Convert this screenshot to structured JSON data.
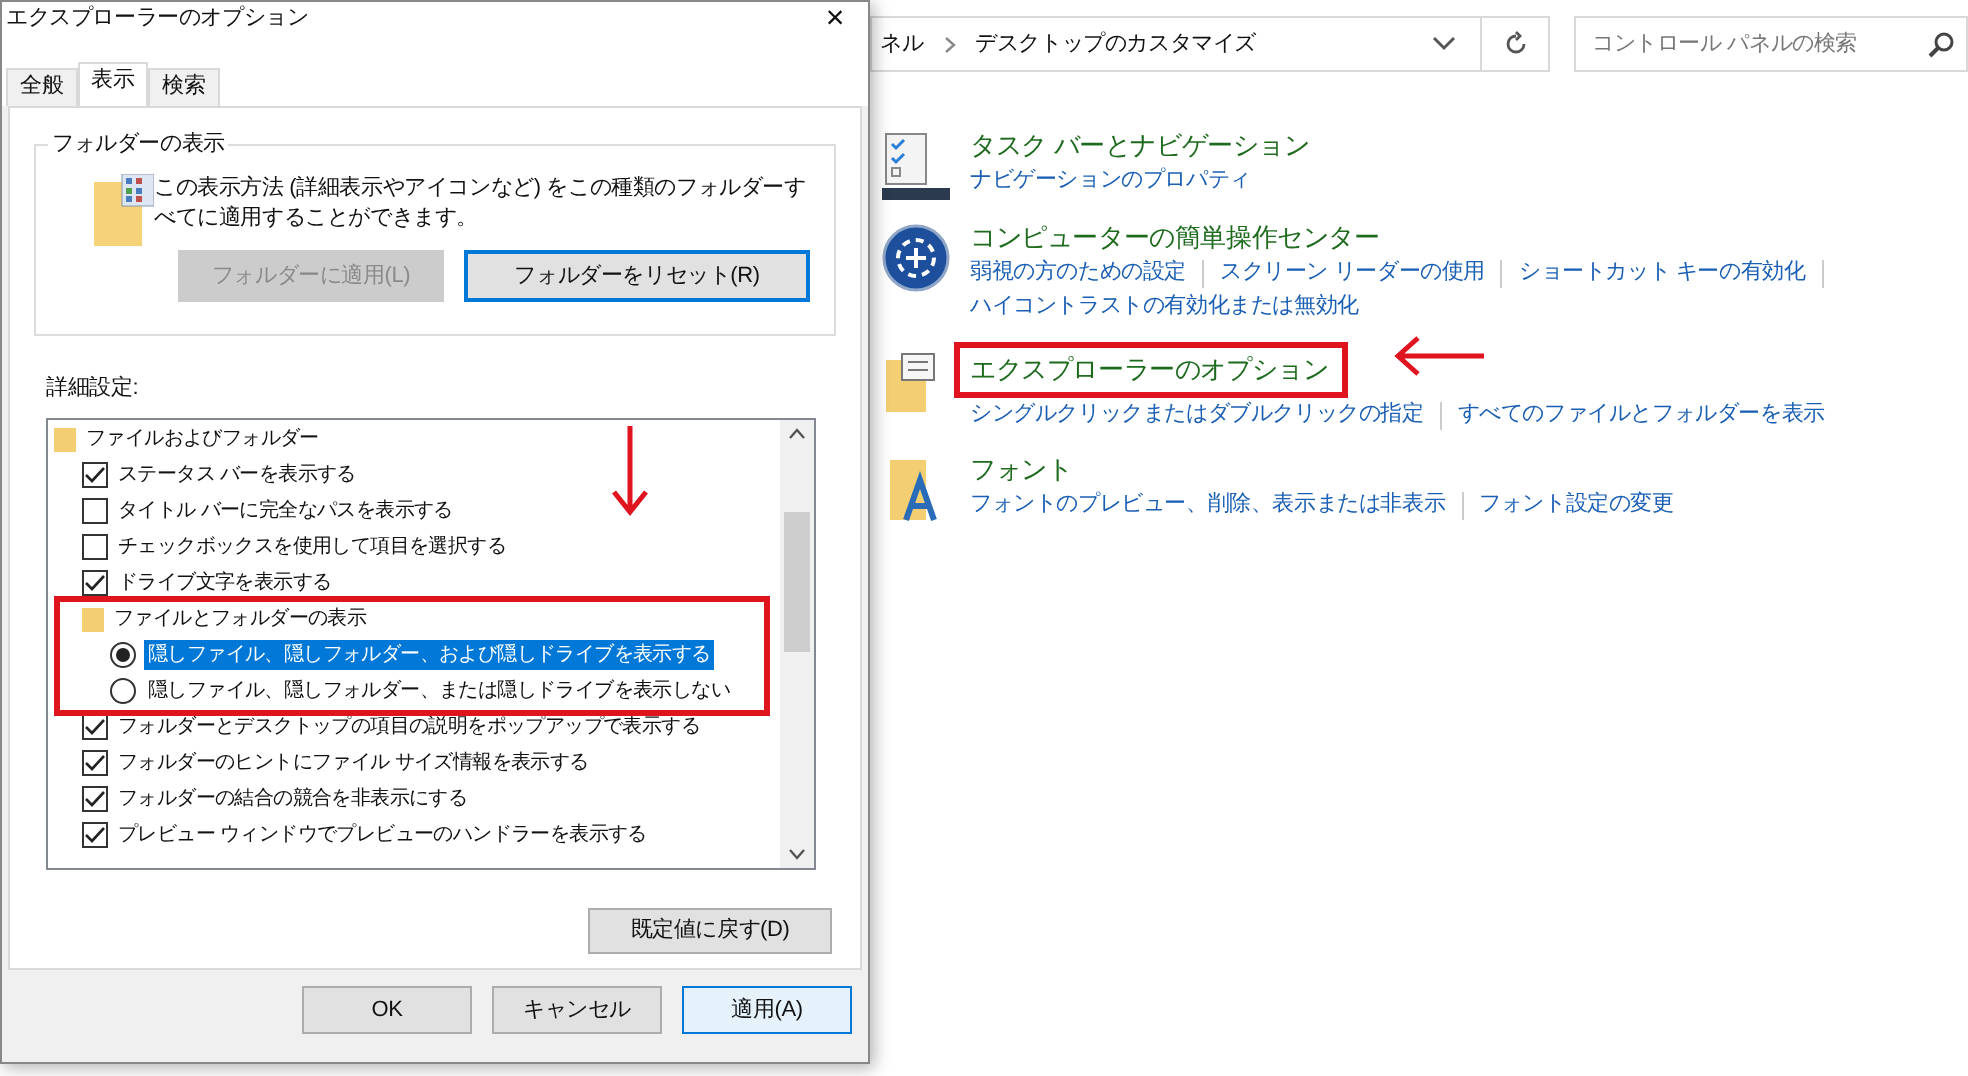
{
  "dialog": {
    "title": "エクスプローラーのオプション",
    "close": "×",
    "tabs": [
      {
        "label": "全般",
        "selected": false
      },
      {
        "label": "表示",
        "selected": true
      },
      {
        "label": "検索",
        "selected": false
      }
    ],
    "folder_views": {
      "legend": "フォルダーの表示",
      "description": "この表示方法 (詳細表示やアイコンなど) をこの種類のフォルダーすべてに適用することができます。",
      "buttons": [
        {
          "label": "フォルダーに適用(L)",
          "disabled": true
        },
        {
          "label": "フォルダーをリセット(R)",
          "disabled": false
        }
      ]
    },
    "advanced": {
      "label": "詳細設定:",
      "items": [
        {
          "kind": "folder",
          "label": "ファイルおよびフォルダー",
          "highlighted": false,
          "children": [
            {
              "kind": "checkbox",
              "label": "ステータス バーを表示する",
              "checked": true
            },
            {
              "kind": "checkbox",
              "label": "タイトル バーに完全なパスを表示する",
              "checked": false
            },
            {
              "kind": "checkbox",
              "label": "チェックボックスを使用して項目を選択する",
              "checked": false
            },
            {
              "kind": "checkbox",
              "label": "ドライブ文字を表示する",
              "checked": true
            },
            {
              "kind": "folder",
              "label": "ファイルとフォルダーの表示",
              "highlighted": true,
              "children": [
                {
                  "kind": "radio",
                  "label": "隠しファイル、隠しフォルダー、および隠しドライブを表示する",
                  "selected": true
                },
                {
                  "kind": "radio",
                  "label": "隠しファイル、隠しフォルダー、または隠しドライブを表示しない",
                  "selected": false
                }
              ]
            },
            {
              "kind": "checkbox",
              "label": "フォルダーとデスクトップの項目の説明をポップアップで表示する",
              "checked": true
            },
            {
              "kind": "checkbox",
              "label": "フォルダーのヒントにファイル サイズ情報を表示する",
              "checked": true
            },
            {
              "kind": "checkbox",
              "label": "フォルダーの結合の競合を非表示にする",
              "checked": true
            },
            {
              "kind": "checkbox",
              "label": "プレビュー ウィンドウでプレビューのハンドラーを表示する",
              "checked": true
            }
          ]
        }
      ],
      "restore": "既定値に戻す(D)"
    },
    "buttons": [
      {
        "label": "OK",
        "default": false
      },
      {
        "label": "キャンセル",
        "default": false
      },
      {
        "label": "適用(A)",
        "default": true
      }
    ]
  },
  "control_panel": {
    "breadcrumb": [
      "ネル",
      "デスクトップのカスタマイズ"
    ],
    "search": {
      "placeholder": "コントロール パネルの検索"
    },
    "sections": [
      {
        "title": "タスク バーとナビゲーション",
        "highlighted": false,
        "links": [
          "ナビゲーションのプロパティ"
        ]
      },
      {
        "title": "コンピューターの簡単操作センター",
        "highlighted": false,
        "links": [
          "弱視の方のための設定",
          "スクリーン リーダーの使用",
          "ショートカット キーの有効化",
          "ハイコントラストの有効化または無効化"
        ]
      },
      {
        "title": "エクスプローラーのオプション",
        "highlighted": true,
        "links": [
          "シングルクリックまたはダブルクリックの指定",
          "すべてのファイルとフォルダーを表示"
        ]
      },
      {
        "title": "フォント",
        "highlighted": false,
        "links": [
          "フォントのプレビュー、削除、表示または非表示",
          "フォント設定の変更"
        ]
      }
    ]
  }
}
